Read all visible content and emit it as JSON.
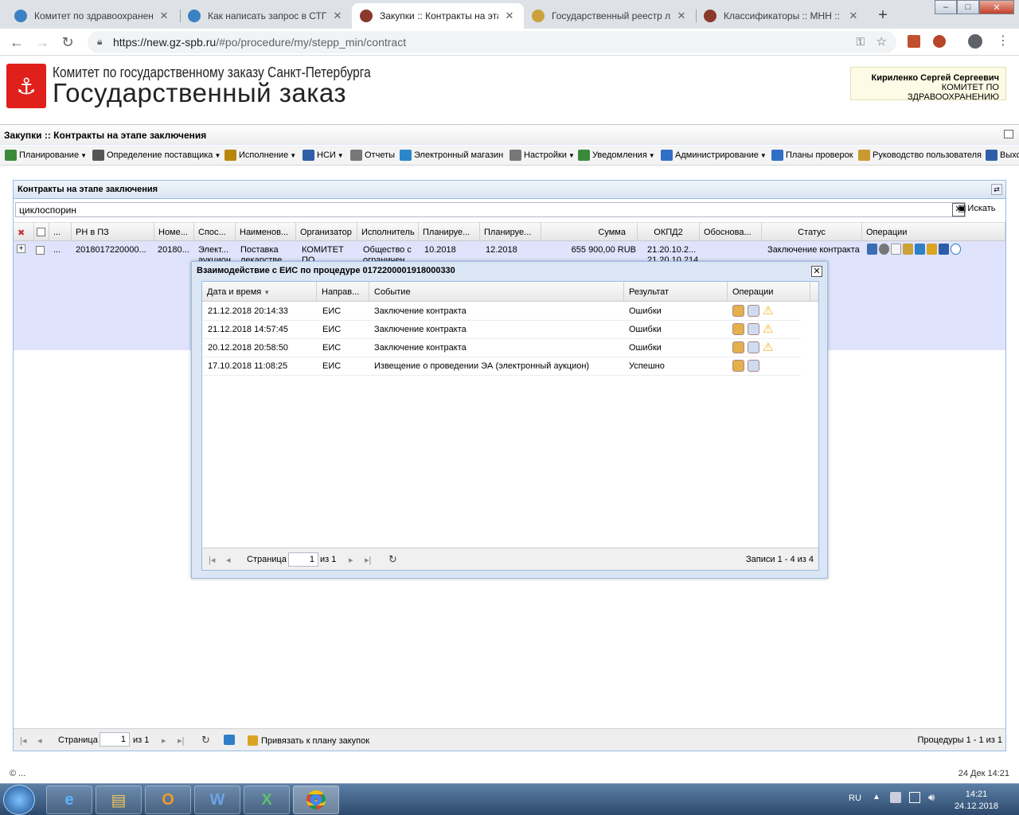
{
  "browser": {
    "tabs": [
      {
        "title": "Комитет по здравоохранени",
        "active": false,
        "icon": "globe-icon"
      },
      {
        "title": "Как написать запрос в СТП",
        "active": false,
        "icon": "globe-icon"
      },
      {
        "title": "Закупки :: Контракты на эта",
        "active": true,
        "icon": "hammer-icon"
      },
      {
        "title": "Государственный реестр ле",
        "active": false,
        "icon": "pills-icon"
      },
      {
        "title": "Классификаторы :: МНН :: А",
        "active": false,
        "icon": "hammer-icon"
      }
    ],
    "new_tab": "+",
    "url_host": "https://new.gz-spb.ru",
    "url_path": "/#po/procedure/my/stepp_min/contract"
  },
  "header": {
    "org_name": "Комитет по государственному заказу Санкт-Петербурга",
    "site_name": "Государственный заказ",
    "user_name": "Кириленко Сергей Сергеевич",
    "user_org": "КОМИТЕТ ПО ЗДРАВООХРАНЕНИЮ"
  },
  "titlebar": "Закупки :: Контракты на этапе заключения",
  "menu": [
    {
      "label": "Планирование",
      "dropdown": true,
      "color": "#3a8a3a"
    },
    {
      "label": "Определение поставщика",
      "dropdown": true,
      "color": "#555"
    },
    {
      "label": "Исполнение",
      "dropdown": true,
      "color": "#b8860b"
    },
    {
      "label": "НСИ",
      "dropdown": true,
      "color": "#2f5fa8"
    },
    {
      "label": "Отчеты",
      "dropdown": false,
      "color": "#777"
    },
    {
      "label": "Электронный магазин",
      "dropdown": false,
      "color": "#2a87c8"
    },
    {
      "label": "Настройки",
      "dropdown": true,
      "color": "#777"
    },
    {
      "label": "Уведомления",
      "dropdown": true,
      "color": "#3a8a3a"
    },
    {
      "label": "Администрирование",
      "dropdown": true,
      "color": "#2f6fc8"
    },
    {
      "label": "Планы проверок",
      "dropdown": false,
      "color": "#2f6fc8"
    },
    {
      "label": "Руководство пользователя",
      "dropdown": false,
      "color": "#c89a30"
    },
    {
      "label": "Выхо",
      "dropdown": false,
      "color": "#2f5fa8"
    }
  ],
  "panel": {
    "title": "Контракты на этапе заключения",
    "search_value": "циклоспорин",
    "search_button": "Искать",
    "columns": [
      "...",
      "РН в ПЗ",
      "Номе...",
      "Спос...",
      "Наименов...",
      "Организатор",
      "Исполнитель",
      "Планируе...",
      "Планируе...",
      "Сумма",
      "ОКПД2",
      "Обоснова...",
      "Статус",
      "Операции"
    ],
    "row": {
      "dots": "...",
      "rn": "2018017220000...",
      "num": "20180...",
      "method": [
        "Элект...",
        "аукцион"
      ],
      "name": [
        "Поставка",
        "лекарстве"
      ],
      "organizer": [
        "КОМИТЕТ",
        "ПО"
      ],
      "executor": [
        "Общество с",
        "ограничен"
      ],
      "plan1": "10.2018",
      "plan2": "12.2018",
      "sum": "655 900,00 RUB",
      "okpd": [
        "21.20.10.2...",
        "21.20.10.214"
      ],
      "status": "Заключение контракта"
    },
    "pager": {
      "page_label": "Страница",
      "page_value": "1",
      "of_label": "из 1",
      "bind_plan": "Привязать к плану закупок",
      "records": "Процедуры 1 - 1 из 1"
    }
  },
  "dialog": {
    "title": "Взаимодействие с ЕИС по процедуре 0172200001918000330",
    "columns": [
      "Дата и время",
      "Направ...",
      "Событие",
      "Результат",
      "Операции"
    ],
    "rows": [
      {
        "datetime": "21.12.2018 20:14:33",
        "direction": "ЕИС",
        "event": "Заключение контракта",
        "result": "Ошибки",
        "warn": true
      },
      {
        "datetime": "21.12.2018 14:57:45",
        "direction": "ЕИС",
        "event": "Заключение контракта",
        "result": "Ошибки",
        "warn": true
      },
      {
        "datetime": "20.12.2018 20:58:50",
        "direction": "ЕИС",
        "event": "Заключение контракта",
        "result": "Ошибки",
        "warn": true
      },
      {
        "datetime": "17.10.2018 11:08:25",
        "direction": "ЕИС",
        "event": "Извещение о проведении ЭА (электронный аукцион)",
        "result": "Успешно",
        "warn": false
      }
    ],
    "pager": {
      "page_label": "Страница",
      "page_value": "1",
      "of_label": "из 1",
      "records": "Записи 1 - 4 из 4"
    }
  },
  "statusline": {
    "left": "© ...",
    "right": "24 Дек 14:21"
  },
  "taskbar": {
    "lang": "RU",
    "time": "14:21",
    "date": "24.12.2018"
  }
}
